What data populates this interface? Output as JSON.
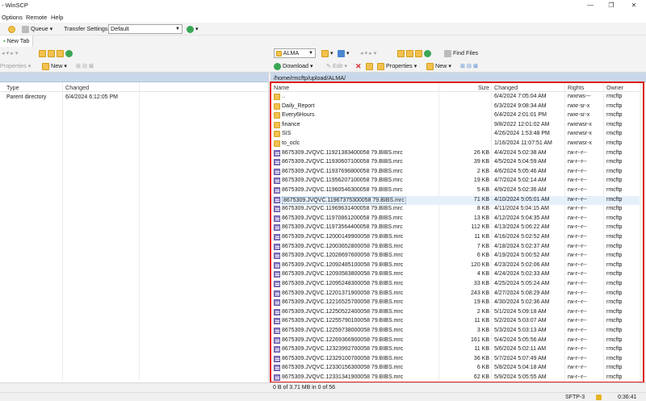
{
  "window": {
    "title": "- WinSCP"
  },
  "menu": [
    "Options",
    "Remote",
    "Help"
  ],
  "toolbar1": {
    "queue_label": "Queue",
    "transfer_settings_label": "Transfer Settings",
    "transfer_settings_value": "Default"
  },
  "tabs": {
    "new_tab_label": "New Tab"
  },
  "left_toolbar": {
    "properties_label": "Properties",
    "new_label": "New"
  },
  "right_toolbar": {
    "location_value": "ALMA",
    "find_files_label": "Find Files",
    "download_label": "Download",
    "edit_label": "Edit",
    "properties_label": "Properties",
    "new_label": "New"
  },
  "left_panel": {
    "columns": {
      "type": "Type",
      "changed": "Changed"
    },
    "rows": [
      {
        "type": "Parent directory",
        "changed": "6/4/2024 6:12:05 PM"
      }
    ]
  },
  "right_panel": {
    "path": "/home/rmcftp/upload/ALMA/",
    "columns": {
      "name": "Name",
      "size": "Size",
      "changed": "Changed",
      "rights": "Rights",
      "owner": "Owner"
    },
    "rows": [
      {
        "icon": "up",
        "name": "..",
        "size": "",
        "changed": "6/4/2024 7:05:04 AM",
        "rights": "rwxrws---",
        "owner": "rmcftp"
      },
      {
        "icon": "folder",
        "name": "Daily_Report",
        "size": "",
        "changed": "6/3/2024 9:08:34 AM",
        "rights": "rwxr-sr-x",
        "owner": "rmcftp"
      },
      {
        "icon": "folder",
        "name": "Every6Hours",
        "size": "",
        "changed": "6/4/2024 2:01:01 PM",
        "rights": "rwxr-sr-x",
        "owner": "rmcftp"
      },
      {
        "icon": "folder",
        "name": "finance",
        "size": "",
        "changed": "9/8/2022 12:01:02 AM",
        "rights": "rwxrwsr-x",
        "owner": "rmcftp"
      },
      {
        "icon": "folder",
        "name": "SIS",
        "size": "",
        "changed": "4/26/2024 1:53:48 PM",
        "rights": "rwxrwsr-x",
        "owner": "rmcftp"
      },
      {
        "icon": "folder",
        "name": "to_oclc",
        "size": "",
        "changed": "1/16/2024 11:07:51 AM",
        "rights": "rwxrwsr-x",
        "owner": "rmcftp"
      },
      {
        "icon": "file",
        "name": "8675309.JVQVC.11921383400058 79.BIBS.mrc",
        "size": "26 KB",
        "changed": "4/4/2024 5:02:38 AM",
        "rights": "rw-r--r--",
        "owner": "rmcftp"
      },
      {
        "icon": "file",
        "name": "8675309.JVQVC.11930607100058 79.BIBS.mrc",
        "size": "39 KB",
        "changed": "4/5/2024 5:04:59 AM",
        "rights": "rw-r--r--",
        "owner": "rmcftp"
      },
      {
        "icon": "file",
        "name": "8675309.JVQVC.11937696800058 79.BIBS.mrc",
        "size": "2 KB",
        "changed": "4/6/2024 5:05:46 AM",
        "rights": "rw-r--r--",
        "owner": "rmcftp"
      },
      {
        "icon": "file",
        "name": "8675309.JVQVC.11956207100058 79.BIBS.mrc",
        "size": "19 KB",
        "changed": "4/7/2024 5:02:14 AM",
        "rights": "rw-r--r--",
        "owner": "rmcftp"
      },
      {
        "icon": "file",
        "name": "8675309.JVQVC.11960546300058 79.BIBS.mrc",
        "size": "5 KB",
        "changed": "4/9/2024 5:02:36 AM",
        "rights": "rw-r--r--",
        "owner": "rmcftp"
      },
      {
        "icon": "file",
        "name": "8675309.JVQVC.11967375300058 79.BIBS.mrc",
        "size": "71 KB",
        "changed": "4/10/2024 5:05:01 AM",
        "rights": "rw-r--r--",
        "owner": "rmcftp"
      },
      {
        "icon": "file",
        "name": "8675309.JVQVC.11969631400058 79.BIBS.mrc",
        "size": "8 KB",
        "changed": "4/11/2024 5:04:15 AM",
        "rights": "rw-r--r--",
        "owner": "rmcftp"
      },
      {
        "icon": "file",
        "name": "8675309.JVQVC.11970861200058 79.BIBS.mrc",
        "size": "13 KB",
        "changed": "4/12/2024 5:04:35 AM",
        "rights": "rw-r--r--",
        "owner": "rmcftp"
      },
      {
        "icon": "file",
        "name": "8675309.JVQVC.11973564400058 79.BIBS.mrc",
        "size": "112 KB",
        "changed": "4/13/2024 5:06:22 AM",
        "rights": "rw-r--r--",
        "owner": "rmcftp"
      },
      {
        "icon": "file",
        "name": "8675309.JVQVC.12000149900058 79.BIBS.mrc",
        "size": "11 KB",
        "changed": "4/16/2024 5:02:52 AM",
        "rights": "rw-r--r--",
        "owner": "rmcftp"
      },
      {
        "icon": "file",
        "name": "8675309.JVQVC.12003652800058 79.BIBS.mrc",
        "size": "7 KB",
        "changed": "4/18/2024 5:02:37 AM",
        "rights": "rw-r--r--",
        "owner": "rmcftp"
      },
      {
        "icon": "file",
        "name": "8675309.JVQVC.12028697600058 79.BIBS.mrc",
        "size": "6 KB",
        "changed": "4/19/2024 5:00:52 AM",
        "rights": "rw-r--r--",
        "owner": "rmcftp"
      },
      {
        "icon": "file",
        "name": "8675309.JVQVC.12092485100058 79.BIBS.mrc",
        "size": "120 KB",
        "changed": "4/23/2024 5:02:06 AM",
        "rights": "rw-r--r--",
        "owner": "rmcftp"
      },
      {
        "icon": "file",
        "name": "8675309.JVQVC.12093583800058 79.BIBS.mrc",
        "size": "4 KB",
        "changed": "4/24/2024 5:02:33 AM",
        "rights": "rw-r--r--",
        "owner": "rmcftp"
      },
      {
        "icon": "file",
        "name": "8675309.JVQVC.12095248300058 79.BIBS.mrc",
        "size": "33 KB",
        "changed": "4/25/2024 5:05:24 AM",
        "rights": "rw-r--r--",
        "owner": "rmcftp"
      },
      {
        "icon": "file",
        "name": "8675309.JVQVC.12201371900058 79.BIBS.mrc",
        "size": "243 KB",
        "changed": "4/27/2024 5:08:29 AM",
        "rights": "rw-r--r--",
        "owner": "rmcftp"
      },
      {
        "icon": "file",
        "name": "8675309.JVQVC.12216525700058 79.BIBS.mrc",
        "size": "19 KB",
        "changed": "4/30/2024 5:02:36 AM",
        "rights": "rw-r--r--",
        "owner": "rmcftp"
      },
      {
        "icon": "file",
        "name": "8675309.JVQVC.12250522400058 79.BIBS.mrc",
        "size": "2 KB",
        "changed": "5/1/2024 5:09:18 AM",
        "rights": "rw-r--r--",
        "owner": "rmcftp"
      },
      {
        "icon": "file",
        "name": "8675309.JVQVC.12255790100058 79.BIBS.mrc",
        "size": "11 KB",
        "changed": "5/2/2024 5:03:07 AM",
        "rights": "rw-r--r--",
        "owner": "rmcftp"
      },
      {
        "icon": "file",
        "name": "8675309.JVQVC.12259738000058 79.BIBS.mrc",
        "size": "3 KB",
        "changed": "5/3/2024 5:03:13 AM",
        "rights": "rw-r--r--",
        "owner": "rmcftp"
      },
      {
        "icon": "file",
        "name": "8675309.JVQVC.12269366900058 79.BIBS.mrc",
        "size": "161 KB",
        "changed": "5/4/2024 5:05:56 AM",
        "rights": "rw-r--r--",
        "owner": "rmcftp"
      },
      {
        "icon": "file",
        "name": "8675309.JVQVC.12323992700058 79.BIBS.mrc",
        "size": "11 KB",
        "changed": "5/6/2024 5:02:11 AM",
        "rights": "rw-r--r--",
        "owner": "rmcftp"
      },
      {
        "icon": "file",
        "name": "8675309.JVQVC.12329100700058 79.BIBS.mrc",
        "size": "36 KB",
        "changed": "5/7/2024 5:07:49 AM",
        "rights": "rw-r--r--",
        "owner": "rmcftp"
      },
      {
        "icon": "file",
        "name": "8675309.JVQVC.12330156300058 79.BIBS.mrc",
        "size": "6 KB",
        "changed": "5/8/2024 5:04:18 AM",
        "rights": "rw-r--r--",
        "owner": "rmcftp"
      },
      {
        "icon": "file",
        "name": "8675309.JVQVC.12331341900058 79.BIBS.mrc",
        "size": "62 KB",
        "changed": "5/9/2024 5:05:55 AM",
        "rights": "rw-r--r--",
        "owner": "rmcftp"
      }
    ],
    "selected_index": 11
  },
  "status": {
    "selection": "0 B of 3.71 MB in 0 of 56",
    "protocol": "SFTP-3",
    "time": "0:36:41"
  },
  "colors": {
    "highlight": "#e0201e",
    "path_bar": "#c8d8ea",
    "selection": "#e6f0fb"
  }
}
